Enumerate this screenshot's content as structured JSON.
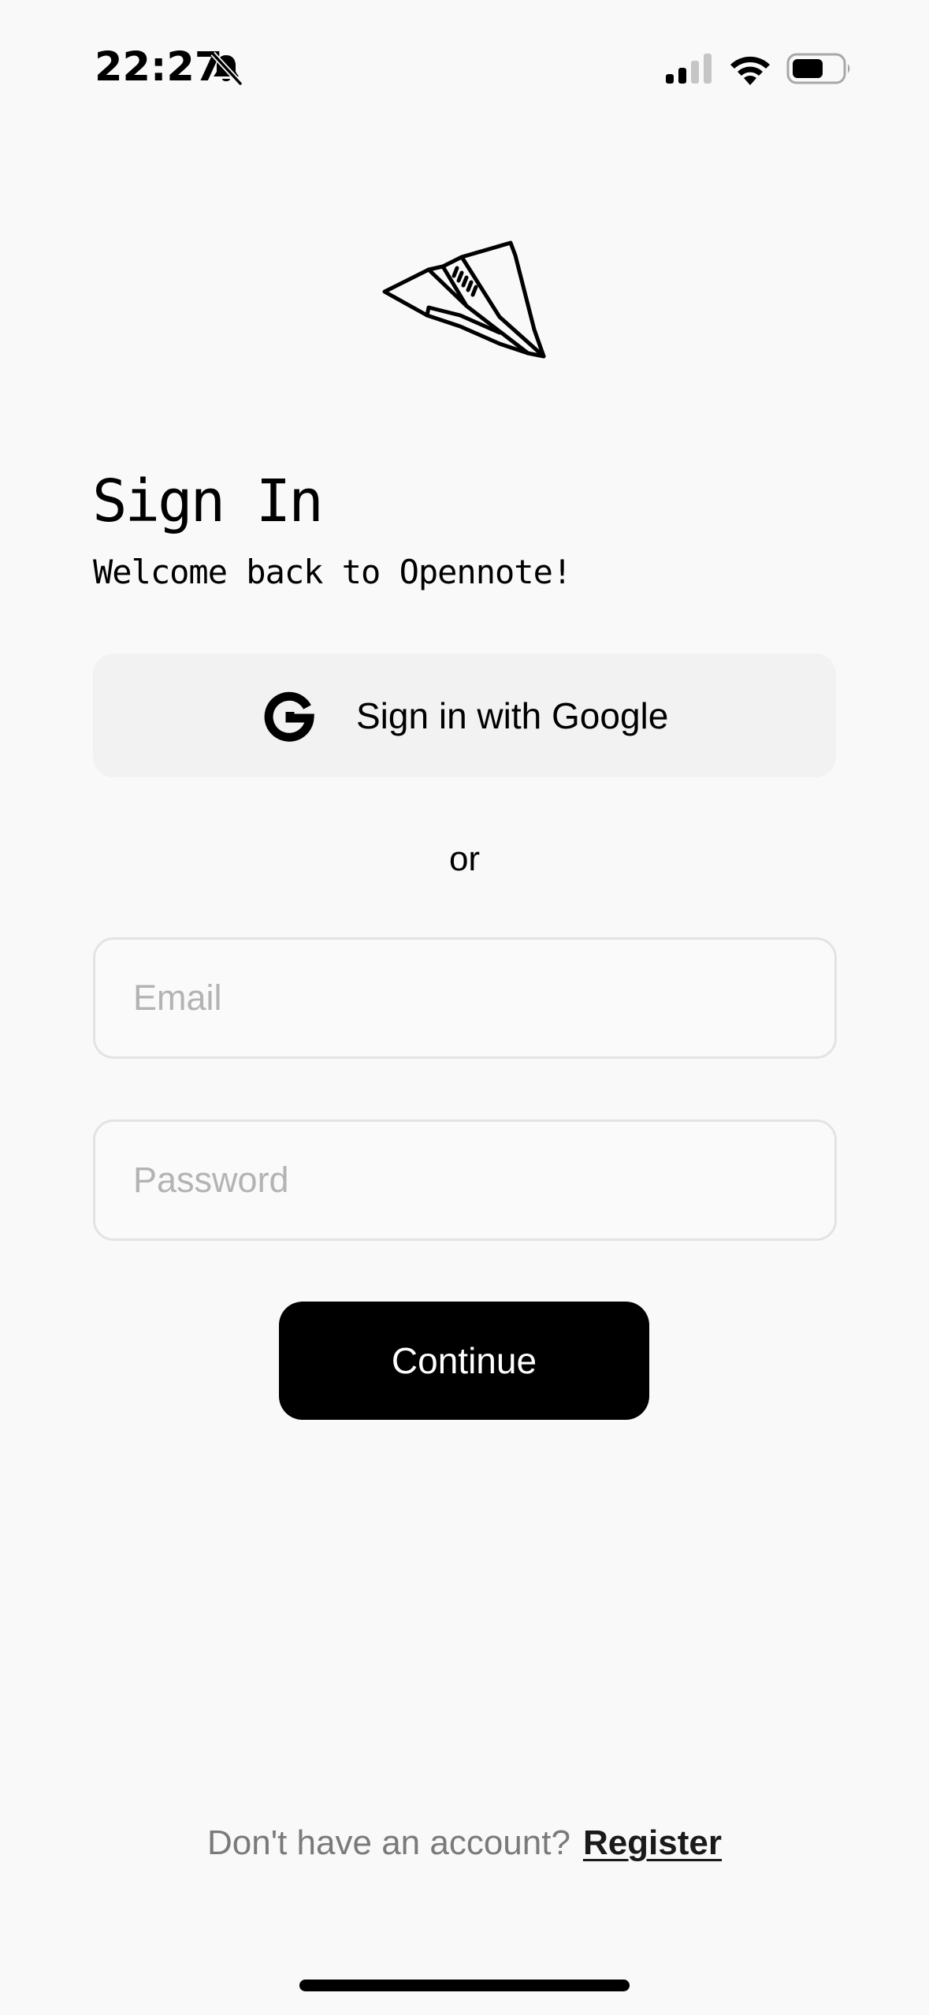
{
  "status_bar": {
    "time": "22:27",
    "icons": [
      "bell-slash-icon",
      "cellular-signal-icon",
      "wifi-icon",
      "battery-icon"
    ]
  },
  "logo": {
    "icon": "paper-plane-icon"
  },
  "header": {
    "title": "Sign In",
    "subtitle": "Welcome back to Opennote!"
  },
  "google_button": {
    "label": "Sign in with Google",
    "icon": "google-icon"
  },
  "divider": {
    "text": "or"
  },
  "form": {
    "email": {
      "placeholder": "Email",
      "value": ""
    },
    "password": {
      "placeholder": "Password",
      "value": ""
    },
    "submit_label": "Continue"
  },
  "footer": {
    "prompt": "Don't have an account?",
    "link_label": "Register"
  },
  "colors": {
    "background": "#f9f9f9",
    "button_primary": "#000000",
    "button_google_bg": "#f2f2f2",
    "input_border": "#e3e3e3",
    "placeholder": "#b3b3b3",
    "muted_text": "#7a7a7a"
  }
}
